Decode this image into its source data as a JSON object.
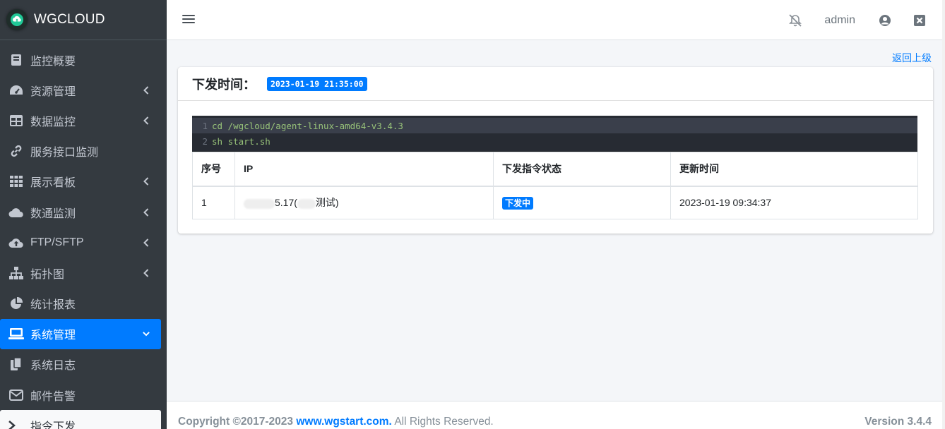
{
  "brand": {
    "name": "WGCLOUD",
    "icon": "cloud-upload-icon"
  },
  "sidebar": {
    "items": [
      {
        "label": "监控概要",
        "icon": "book-icon",
        "has_children": false
      },
      {
        "label": "资源管理",
        "icon": "tachometer-icon",
        "has_children": true
      },
      {
        "label": "数据监控",
        "icon": "table-icon",
        "has_children": true
      },
      {
        "label": "服务接口监测",
        "icon": "link-icon",
        "has_children": false
      },
      {
        "label": "展示看板",
        "icon": "grid-icon",
        "has_children": true
      },
      {
        "label": "数通监测",
        "icon": "cloud-icon",
        "has_children": true
      },
      {
        "label": "FTP/SFTP",
        "icon": "cloud-upload-icon",
        "has_children": true
      },
      {
        "label": "拓扑图",
        "icon": "sitemap-icon",
        "has_children": true
      },
      {
        "label": "统计报表",
        "icon": "pie-chart-icon",
        "has_children": false
      },
      {
        "label": "系统管理",
        "icon": "laptop-icon",
        "has_children": true,
        "expanded": true,
        "active": true
      },
      {
        "label": "系统日志",
        "icon": "copy-icon",
        "has_children": false
      },
      {
        "label": "邮件告警",
        "icon": "envelope-icon",
        "has_children": false
      },
      {
        "label": "指令下发",
        "icon": "terminal-icon",
        "has_children": false,
        "selected": true
      }
    ]
  },
  "topbar": {
    "menu_icon": "hamburger-icon",
    "bell_icon": "bell-slash-icon",
    "user_label": "admin",
    "user_icon": "user-circle-icon",
    "close_icon": "close-square-icon"
  },
  "content": {
    "back_link": "返回上级",
    "card": {
      "title": "下发时间：",
      "time": "2023-01-19 21:35:00"
    },
    "code_lines": [
      {
        "no": "1",
        "text": "cd /wgcloud/agent-linux-amd64-v3.4.3"
      },
      {
        "no": "2",
        "text": "sh start.sh"
      }
    ],
    "table": {
      "headers": [
        "序号",
        "IP",
        "下发指令状态",
        "更新时间"
      ],
      "rows": [
        {
          "index": "1",
          "ip_visible": "5.17(",
          "ip_suffix": "测试)",
          "status": "下发中",
          "updated": "2023-01-19 09:34:37"
        }
      ]
    }
  },
  "footer": {
    "copyright_prefix": "Copyright ©2017-2023 ",
    "site": "www.wgstart.com.",
    "rights": " All Rights Reserved.",
    "version": "Version 3.4.4"
  },
  "colors": {
    "sidebar_bg": "#343a40",
    "accent": "#007bff",
    "page_bg": "#f4f6f9"
  }
}
